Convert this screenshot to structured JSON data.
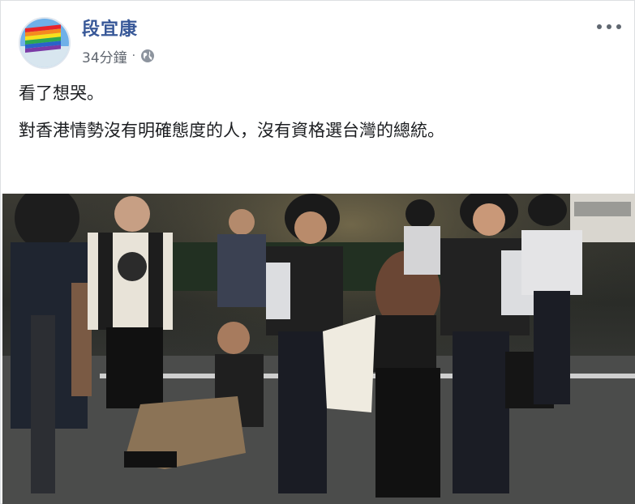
{
  "post": {
    "author": "段宜康",
    "time": "34分鐘",
    "separator": "·",
    "privacy_icon": "globe-icon",
    "more_icon": "more-options-icon",
    "lines": [
      "看了想哭。",
      "對香港情勢沒有明確態度的人，沒有資格選台灣的總統。"
    ]
  },
  "colors": {
    "author_link": "#385898",
    "meta_text": "#616770",
    "body_text": "#1c1e21"
  }
}
